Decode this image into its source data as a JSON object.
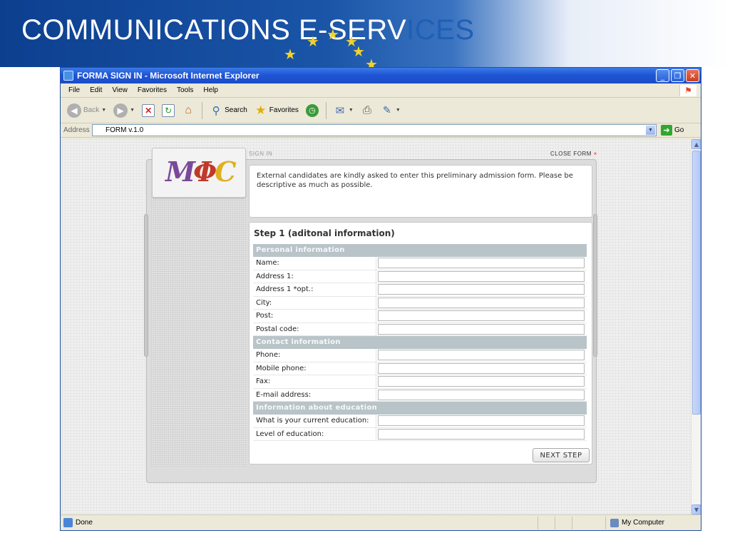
{
  "slide": {
    "title_main": "COMMUNICATIONS E-SERV",
    "title_accent": "ICES"
  },
  "window": {
    "title": "FORMA SIGN IN - Microsoft Internet Explorer",
    "buttons": {
      "minimize": "_",
      "maximize": "❐",
      "close": "✕"
    }
  },
  "menu": [
    "File",
    "Edit",
    "View",
    "Favorites",
    "Tools",
    "Help"
  ],
  "toolbar": {
    "back": "Back",
    "search": "Search",
    "favorites": "Favorites"
  },
  "address": {
    "label": "Address",
    "value": "FORM v.1.0",
    "go": "Go"
  },
  "form": {
    "sign_in_label": "SIGN IN",
    "close_label": "CLOSE FORM",
    "close_x": "×",
    "intro": "External candidates are kindly asked to enter this preliminary admission form. Please be descriptive as much as possible.",
    "step_title": "Step 1 (aditonal information)",
    "sections": {
      "personal": {
        "header": "Personal information",
        "fields": [
          "Name:",
          "Address 1:",
          "Address 1 *opt.:",
          "City:",
          "Post:",
          "Postal code:"
        ]
      },
      "contact": {
        "header": "Contact information",
        "fields": [
          "Phone:",
          "Mobile phone:",
          "Fax:",
          "E-mail address:"
        ]
      },
      "education": {
        "header": "Information about education",
        "fields": [
          "What is your current education:",
          "Level of education:"
        ]
      }
    },
    "next_button": "NEXT STEP"
  },
  "status": {
    "text": "Done",
    "zone": "My Computer"
  }
}
